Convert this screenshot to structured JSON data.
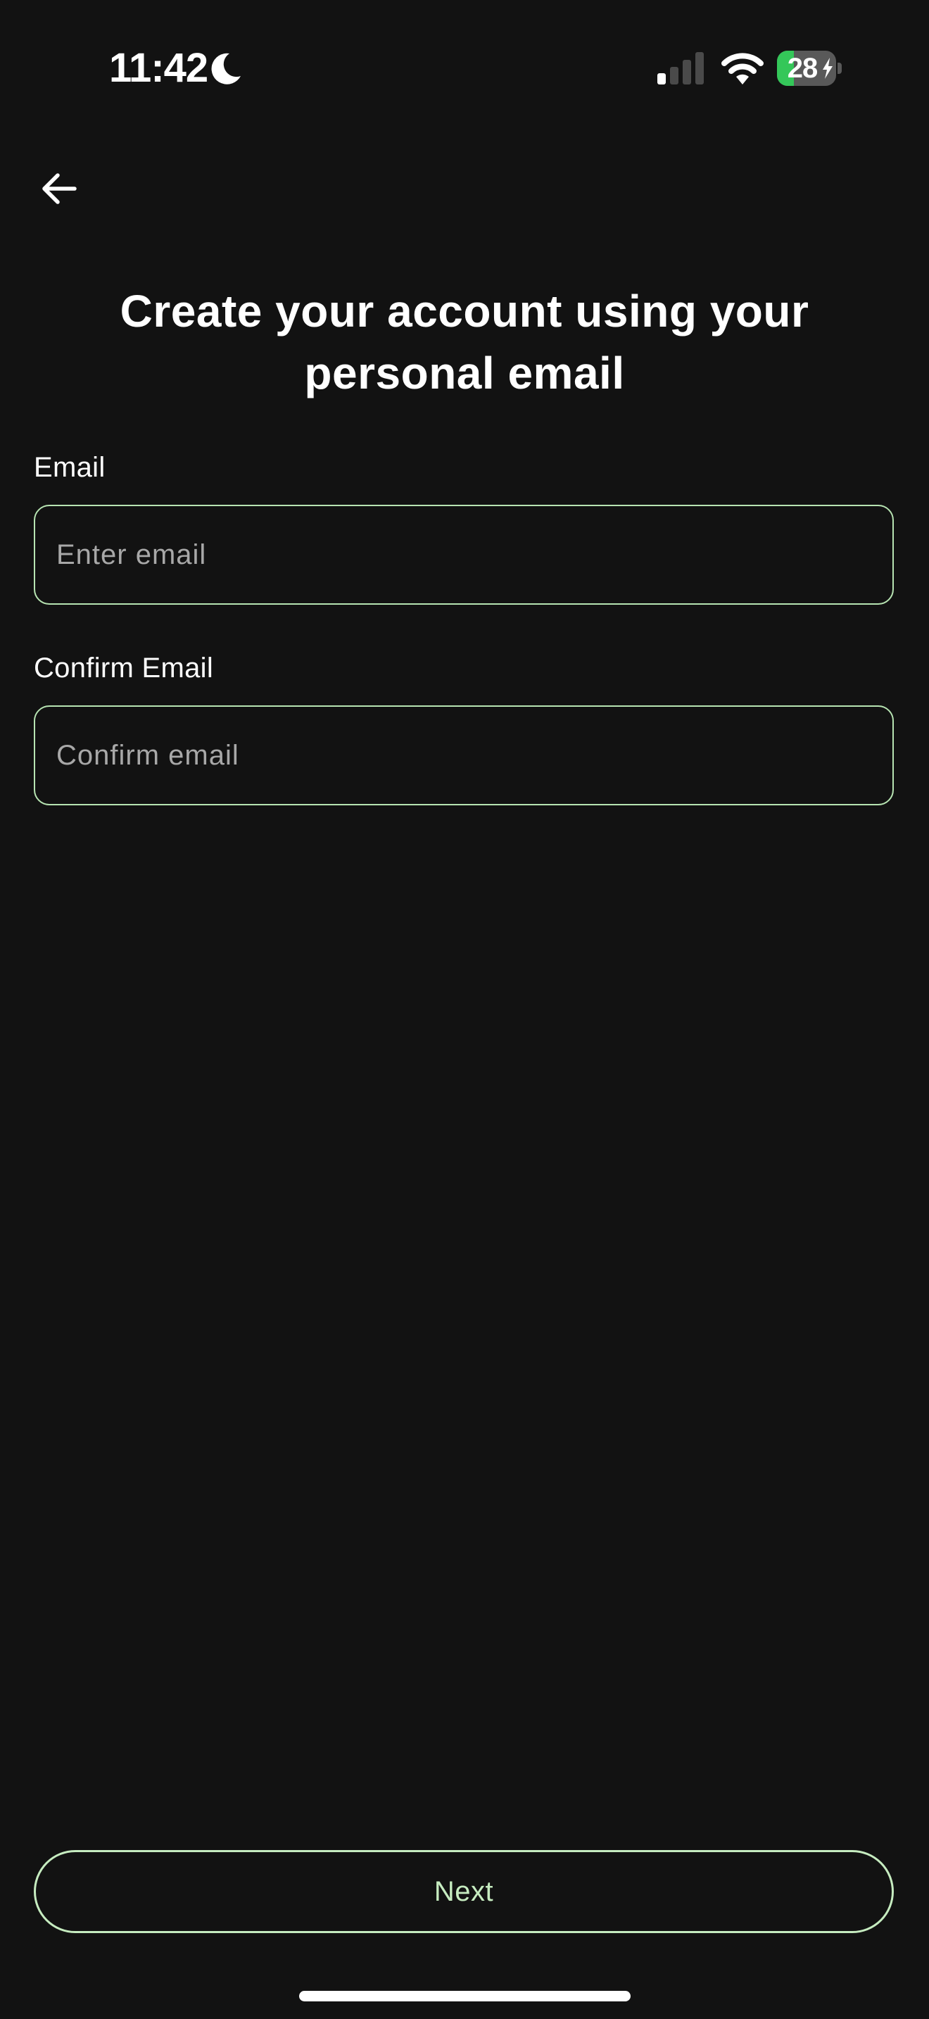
{
  "status_bar": {
    "time": "11:42",
    "battery_level": "28",
    "battery_fraction": 0.28,
    "battery_charging": true,
    "signal_bars_active": 1,
    "signal_bars_total": 4,
    "focus_mode_icon": "moon-icon",
    "wifi_icon": "wifi-icon"
  },
  "header": {
    "back_icon": "arrow-left-icon"
  },
  "title": "Create your account using your personal email",
  "form": {
    "email": {
      "label": "Email",
      "value": "",
      "placeholder": "Enter email"
    },
    "confirm_email": {
      "label": "Confirm Email",
      "value": "",
      "placeholder": "Confirm email"
    }
  },
  "actions": {
    "next_label": "Next"
  },
  "colors": {
    "background": "#121212",
    "accent": "#c6ecc0",
    "input_border": "#b7e4b2",
    "placeholder": "#a8a8a8",
    "battery_green": "#34c759"
  }
}
